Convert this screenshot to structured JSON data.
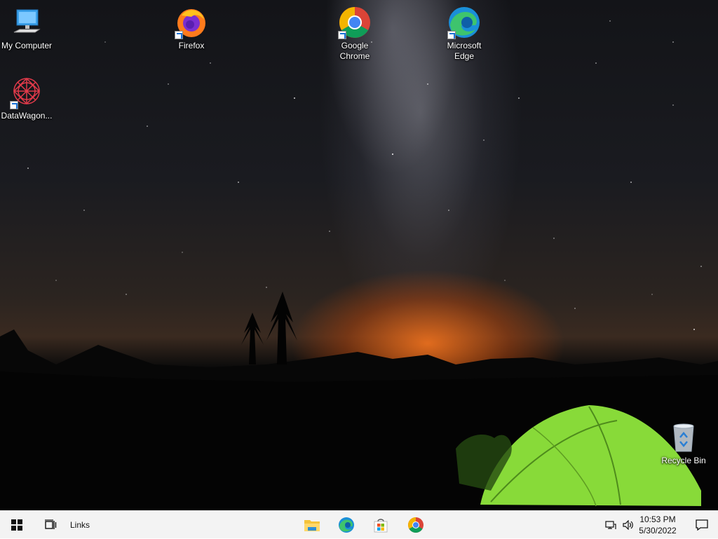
{
  "desktop": {
    "icons": [
      {
        "label": "My Computer"
      },
      {
        "label": "Firefox"
      },
      {
        "label": "Google Chrome"
      },
      {
        "label": "Microsoft Edge"
      },
      {
        "label": "DataWagon..."
      },
      {
        "label": "Recycle Bin"
      }
    ]
  },
  "taskbar": {
    "links_label": "Links",
    "pinned": [
      "file-explorer-icon",
      "edge-icon",
      "store-icon",
      "chrome-icon"
    ],
    "clock": {
      "time": "10:53 PM",
      "date": "5/30/2022"
    }
  },
  "colors": {
    "taskbar_bg": "#f3f3f3",
    "tent_green": "#8fe63c",
    "horizon_orange": "#ff7a1e"
  }
}
